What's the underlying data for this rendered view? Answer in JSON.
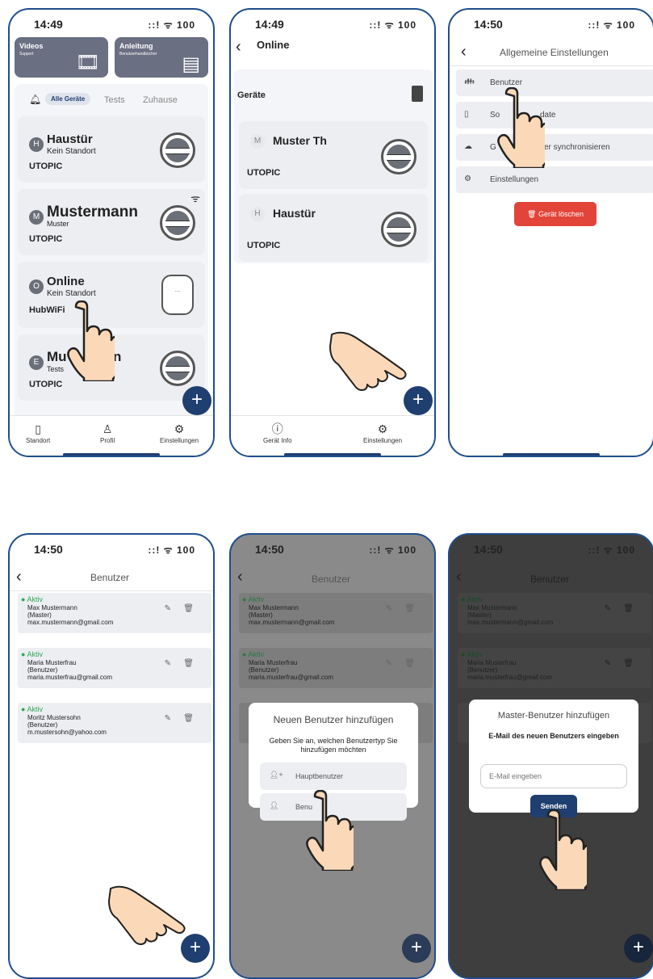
{
  "status": {
    "t1": "14:49",
    "t2": "14:49",
    "t3": "14:50",
    "t4": "14:50",
    "t5": "14:50",
    "t6": "14:50",
    "signal": "::! ᯤ 100"
  },
  "screen1": {
    "banner_videos": {
      "title": "Videos",
      "subtitle": "Support"
    },
    "banner_manual": {
      "title": "Anleitung",
      "subtitle": "Benutzerhandbücher"
    },
    "tabs": [
      "Alle Geräte",
      "Tests",
      "Zuhause"
    ],
    "devices": [
      {
        "initial": "H",
        "name": "Haustür",
        "sub": "Kein Standort",
        "type": "UTOPIC"
      },
      {
        "initial": "M",
        "name": "Mustermann",
        "sub": "Muster",
        "type": "UTOPIC"
      },
      {
        "initial": "O",
        "name": "Online",
        "sub": "Kein Standort",
        "type": "HubWiFi"
      },
      {
        "initial": "E",
        "name": "Mu",
        "name_end": "n",
        "sub": "Tests",
        "type": "UTOPIC"
      }
    ],
    "hub_text": "---",
    "nav": [
      "Standort",
      "Profil",
      "Einstellungen"
    ]
  },
  "screen2": {
    "title": "Online",
    "section": "Geräte",
    "devices": [
      {
        "initial": "M",
        "name": "Muster Th",
        "type": "UTOPIC"
      },
      {
        "initial": "H",
        "name": "Haustür",
        "type": "UTOPIC"
      }
    ],
    "nav": [
      "Gerät Info",
      "Einstellungen"
    ]
  },
  "screen3": {
    "title": "Allgemeine Einstellungen",
    "rows": [
      {
        "icon": "users-icon",
        "label": "Benutzer"
      },
      {
        "icon": "phone-icon",
        "label_start": "So",
        "label_end": "date"
      },
      {
        "icon": "cloud-icon",
        "label_start": "G",
        "label_end": "ver synchronisieren"
      },
      {
        "icon": "gear-icon",
        "label": "Einstellungen"
      }
    ],
    "delete_button": "Gerät löschen"
  },
  "users": {
    "title": "Benutzer",
    "list": [
      {
        "status": "Aktiv",
        "name": "Max Mustermann",
        "role": "(Master)",
        "email": "max.mustermann@gmail.com"
      },
      {
        "status": "Aktiv",
        "name": "Maria Musterfrau",
        "role": "(Benutzer)",
        "email": "maria.musterfrau@gmail.com"
      },
      {
        "status": "Aktiv",
        "name": "Moritz Mustersohn",
        "role": "(Benutzer)",
        "email": "m.mustersohn@yahoo.com"
      }
    ]
  },
  "screen5": {
    "dialog_title": "Neuen Benutzer hinzufügen",
    "dialog_text": "Geben Sie an, welchen Benutzertyp Sie hinzufügen möchten",
    "option1": "Hauptbenutzer",
    "option2": "Benu"
  },
  "screen6": {
    "dialog_title": "Master-Benutzer hinzufügen",
    "dialog_subtitle": "E-Mail des neuen Benutzers eingeben",
    "email_placeholder": "E-Mail eingeben",
    "send_button": "Senden"
  },
  "colors": {
    "accent": "#1f3f70",
    "danger": "#e2443a",
    "active": "#2fa84f",
    "card": "#eceef2"
  }
}
